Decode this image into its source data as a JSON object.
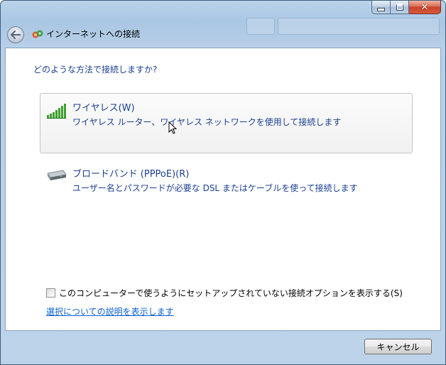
{
  "window": {
    "title": "インターネットへの接続",
    "caption_buttons": {
      "minimize": "minimize-icon",
      "maximize": "maximize-icon",
      "close": "✕"
    }
  },
  "content": {
    "question": "どのような方法で接続しますか?",
    "options": [
      {
        "title": "ワイヤレス(W)",
        "description": "ワイヤレス ルーター、ワイヤレス ネットワークを使用して接続します",
        "icon": "wireless-signal-icon"
      },
      {
        "title": "ブロードバンド (PPPoE)(R)",
        "description": "ユーザー名とパスワードが必要な DSL またはケーブルを使って接続します",
        "icon": "broadband-modem-icon"
      }
    ],
    "checkbox_label": "このコンピューターで使うようにセットアップされていない接続オプションを表示する(S)",
    "checkbox_checked": false,
    "help_link": "選択についての説明を表示します"
  },
  "footer": {
    "cancel_label": "キャンセル"
  },
  "colors": {
    "link_blue": "#1b3f8e",
    "hyperlink": "#0b5fd0",
    "frame": "#a9c6e3"
  }
}
